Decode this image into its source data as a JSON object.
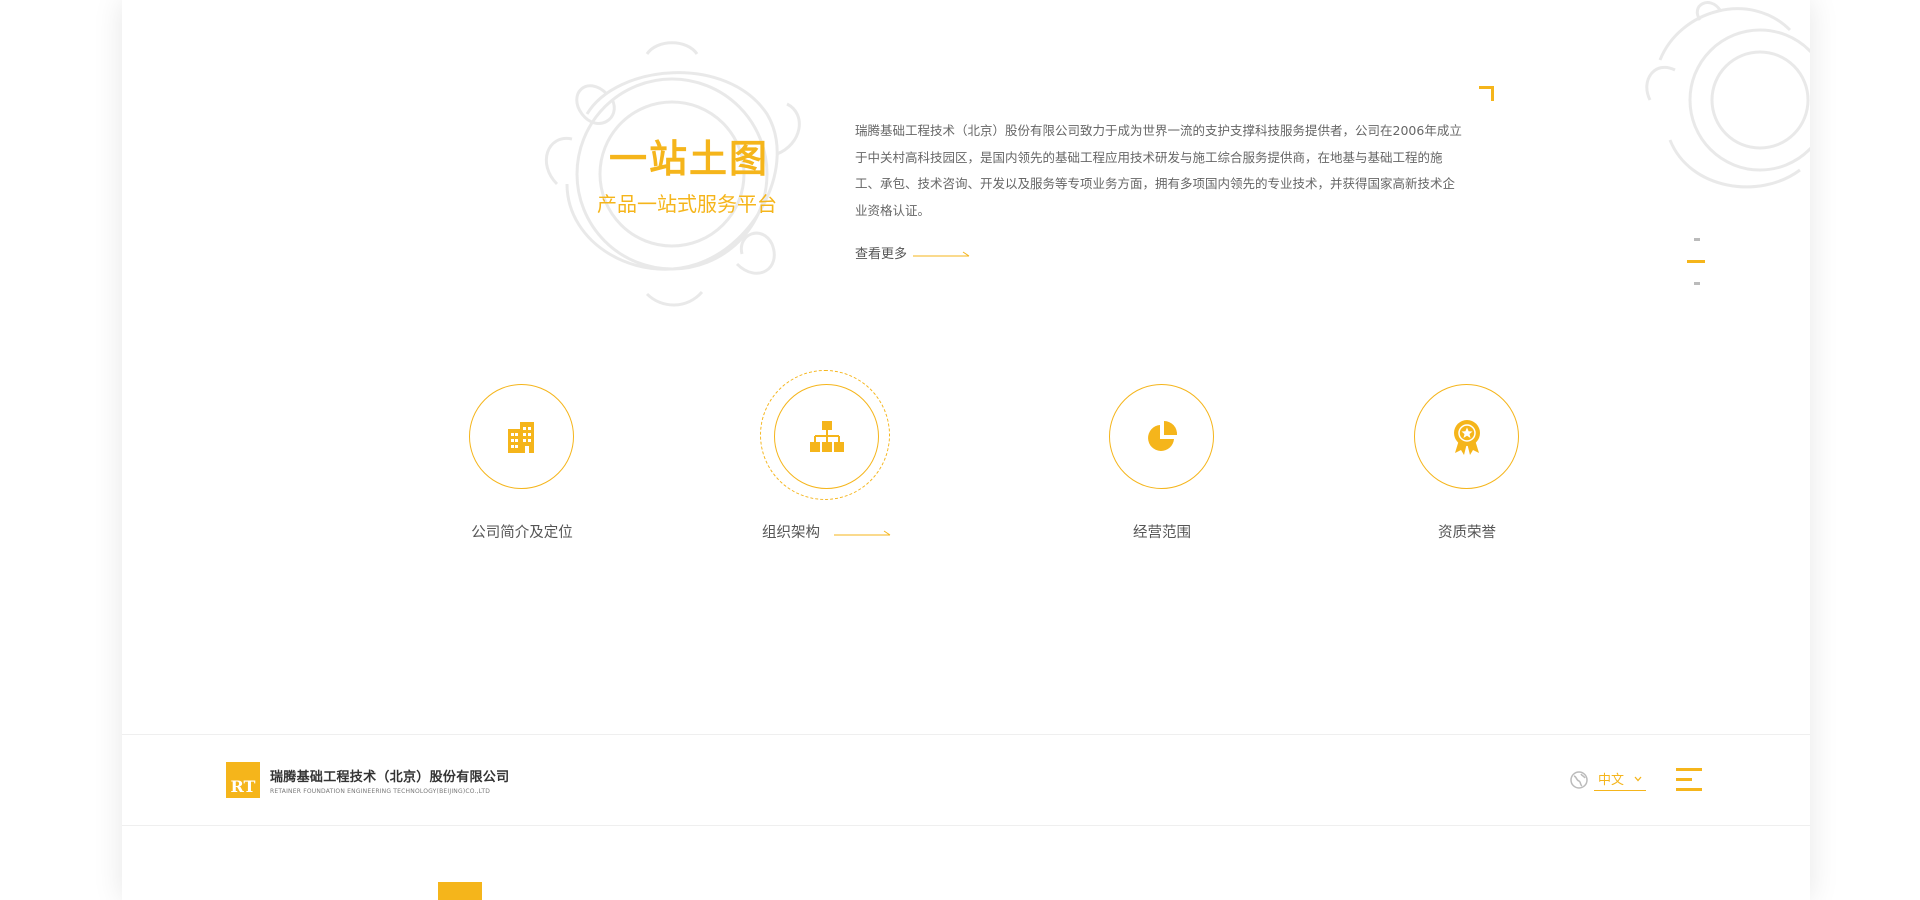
{
  "hero": {
    "title": "一站土图",
    "subtitle": "产品一站式服务平台",
    "intro": "瑞腾基础工程技术（北京）股份有限公司致力于成为世界一流的支护支撑科技服务提供者，公司在2006年成立于中关村高科技园区，是国内领先的基础工程应用技术研发与施工综合服务提供商，在地基与基础工程的施工、承包、技术咨询、开发以及服务等专项业务方面，拥有多项国内领先的专业技术，并获得国家高新技术企业资格认证。",
    "more_label": "查看更多"
  },
  "features": [
    {
      "label": "公司简介及定位",
      "icon": "building-icon"
    },
    {
      "label": "组织架构",
      "icon": "org-chart-icon"
    },
    {
      "label": "经营范围",
      "icon": "pie-chart-icon"
    },
    {
      "label": "资质荣誉",
      "icon": "award-badge-icon"
    }
  ],
  "footer": {
    "company_name": "瑞腾基础工程技术（北京）股份有限公司",
    "company_name_en": "RETAINER FOUNDATION ENGINEERING TECHNOLOGY(BEIJING)CO.,LTD",
    "logo_letters": "RT",
    "language": "中文"
  },
  "colors": {
    "accent": "#f5b51b",
    "text": "#333333",
    "muted": "#666666"
  }
}
